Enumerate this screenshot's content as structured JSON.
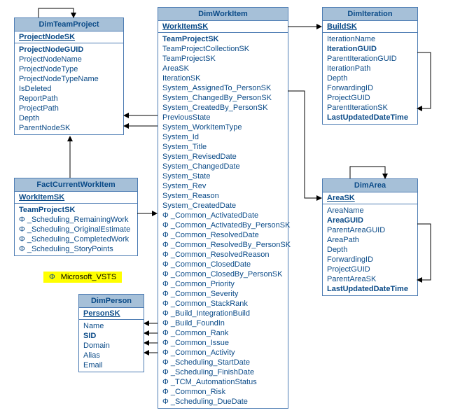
{
  "legend": {
    "symbol": "Φ",
    "text": "Microsoft_VSTS"
  },
  "tables": {
    "dimteamproject": {
      "title": "DimTeamProject",
      "key": "ProjectNodeSK",
      "fields": [
        {
          "t": "ProjectNodeGUID",
          "b": true
        },
        {
          "t": "ProjectNodeName"
        },
        {
          "t": "ProjectNodeType"
        },
        {
          "t": "ProjectNodeTypeName"
        },
        {
          "t": "IsDeleted"
        },
        {
          "t": "ReportPath"
        },
        {
          "t": "ProjectPath"
        },
        {
          "t": "Depth"
        },
        {
          "t": "ParentNodeSK"
        }
      ]
    },
    "factcurrentworkitem": {
      "title": "FactCurrentWorkItem",
      "key": "WorkItemSK",
      "fields": [
        {
          "t": "TeamProjectSK",
          "b": true
        },
        {
          "t": "Φ _Scheduling_RemainingWork"
        },
        {
          "t": "Φ _Scheduling_OriginalEstimate"
        },
        {
          "t": "Φ _Scheduling_CompletedWork"
        },
        {
          "t": "Φ _Scheduling_StoryPoints"
        }
      ]
    },
    "dimperson": {
      "title": "DimPerson",
      "key": "PersonSK",
      "fields": [
        {
          "t": "Name"
        },
        {
          "t": "SID",
          "b": true
        },
        {
          "t": "Domain"
        },
        {
          "t": "Alias"
        },
        {
          "t": "Email"
        }
      ]
    },
    "dimworkitem": {
      "title": "DimWorkItem",
      "key": "WorkItemSK",
      "fields": [
        {
          "t": "TeamProjectSK",
          "b": true
        },
        {
          "t": "TeamProjectCollectionSK"
        },
        {
          "t": "TeamProjectSK"
        },
        {
          "t": "AreaSK"
        },
        {
          "t": "IterationSK"
        },
        {
          "t": "System_AssignedTo_PersonSK"
        },
        {
          "t": "System_ChangedBy_PersonSK"
        },
        {
          "t": "System_CreatedBy_PersonSK"
        },
        {
          "t": "PreviousState"
        },
        {
          "t": "System_WorkItemType"
        },
        {
          "t": "System_Id"
        },
        {
          "t": "System_Title"
        },
        {
          "t": "System_RevisedDate"
        },
        {
          "t": "System_ChangedDate"
        },
        {
          "t": "System_State"
        },
        {
          "t": "System_Rev"
        },
        {
          "t": "System_Reason"
        },
        {
          "t": "System_CreatedDate"
        },
        {
          "t": "Φ _Common_ActivatedDate"
        },
        {
          "t": "Φ _Common_ActivatedBy_PersonSK"
        },
        {
          "t": "Φ _Common_ResolvedDate"
        },
        {
          "t": "Φ _Common_ResolvedBy_PersonSK"
        },
        {
          "t": "Φ _Common_ResolvedReason"
        },
        {
          "t": "Φ _Common_ClosedDate"
        },
        {
          "t": "Φ _Common_ClosedBy_PersonSK"
        },
        {
          "t": "Φ _Common_Priority"
        },
        {
          "t": "Φ _Common_Severity"
        },
        {
          "t": "Φ _Common_StackRank"
        },
        {
          "t": "Φ _Build_IntegrationBuild"
        },
        {
          "t": "Φ _Build_FoundIn"
        },
        {
          "t": "Φ _Common_Rank"
        },
        {
          "t": "Φ _Common_Issue"
        },
        {
          "t": "Φ _Common_Activity"
        },
        {
          "t": "Φ _Scheduling_StartDate"
        },
        {
          "t": "Φ _Scheduling_FinishDate"
        },
        {
          "t": "Φ _TCM_AutomationStatus"
        },
        {
          "t": "Φ _Common_Risk"
        },
        {
          "t": "Φ _Scheduling_DueDate"
        }
      ]
    },
    "dimiteration": {
      "title": "DimIteration",
      "key": "BuildSK",
      "fields": [
        {
          "t": "IterationName"
        },
        {
          "t": "IterationGUID",
          "b": true
        },
        {
          "t": "ParentIterationGUID"
        },
        {
          "t": "IterationPath"
        },
        {
          "t": "Depth"
        },
        {
          "t": "ForwardingID"
        },
        {
          "t": "ProjectGUID"
        },
        {
          "t": "ParentIterationSK"
        },
        {
          "t": "LastUpdatedDateTime",
          "b": true
        }
      ]
    },
    "dimarea": {
      "title": "DimArea",
      "key": "AreaSK",
      "fields": [
        {
          "t": "AreaName"
        },
        {
          "t": "AreaGUID",
          "b": true
        },
        {
          "t": "ParentAreaGUID"
        },
        {
          "t": "AreaPath"
        },
        {
          "t": "Depth"
        },
        {
          "t": "ForwardingID"
        },
        {
          "t": "ProjectGUID"
        },
        {
          "t": "ParentAreaSK"
        },
        {
          "t": "LastUpdatedDateTime",
          "b": true
        }
      ]
    }
  }
}
